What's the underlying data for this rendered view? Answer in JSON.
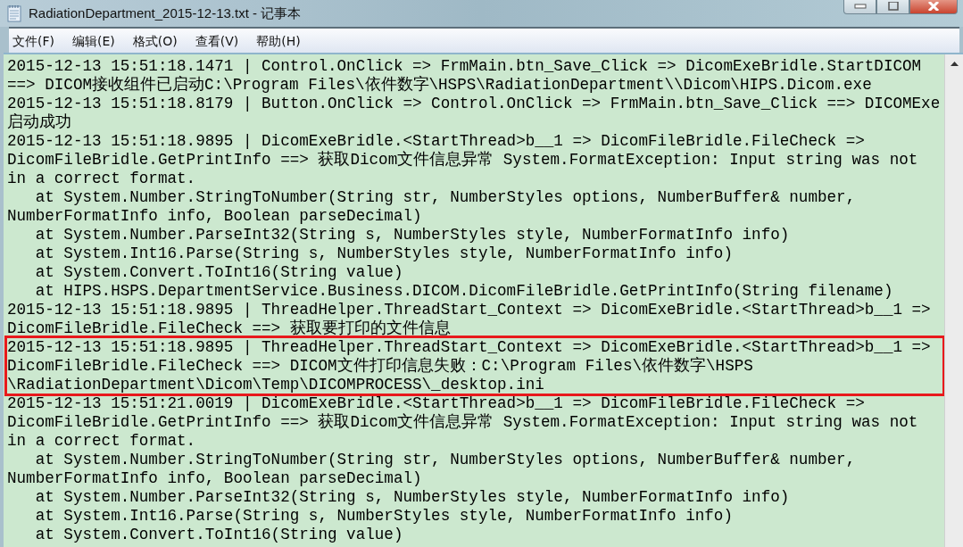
{
  "window": {
    "title": "RadiationDepartment_2015-12-13.txt - 记事本"
  },
  "menu": [
    "文件(F)",
    "编辑(E)",
    "格式(O)",
    "查看(V)",
    "帮助(H)"
  ],
  "lines": [
    {
      "text": "2015-12-13 15:51:18.1471 | Control.OnClick => FrmMain.btn_Save_Click => DicomExeBridle.StartDICOM",
      "boxed": false
    },
    {
      "text": "==> DICOM接收组件已启动C:\\Program Files\\依件数字\\HSPS\\RadiationDepartment\\\\Dicom\\HIPS.Dicom.exe",
      "boxed": false
    },
    {
      "text": "2015-12-13 15:51:18.8179 | Button.OnClick => Control.OnClick => FrmMain.btn_Save_Click ==> DICOMExe",
      "boxed": false
    },
    {
      "text": "启动成功",
      "boxed": false
    },
    {
      "text": "2015-12-13 15:51:18.9895 | DicomExeBridle.<StartThread>b__1 => DicomFileBridle.FileCheck =>",
      "boxed": false
    },
    {
      "text": "DicomFileBridle.GetPrintInfo ==> 获取Dicom文件信息异常 System.FormatException: Input string was not",
      "boxed": false
    },
    {
      "text": "in a correct format.",
      "boxed": false
    },
    {
      "text": "   at System.Number.StringToNumber(String str, NumberStyles options, NumberBuffer& number,",
      "boxed": false
    },
    {
      "text": "NumberFormatInfo info, Boolean parseDecimal)",
      "boxed": false
    },
    {
      "text": "   at System.Number.ParseInt32(String s, NumberStyles style, NumberFormatInfo info)",
      "boxed": false
    },
    {
      "text": "   at System.Int16.Parse(String s, NumberStyles style, NumberFormatInfo info)",
      "boxed": false
    },
    {
      "text": "   at System.Convert.ToInt16(String value)",
      "boxed": false
    },
    {
      "text": "   at HIPS.HSPS.DepartmentService.Business.DICOM.DicomFileBridle.GetPrintInfo(String filename)",
      "boxed": false
    },
    {
      "text": "2015-12-13 15:51:18.9895 | ThreadHelper.ThreadStart_Context => DicomExeBridle.<StartThread>b__1 =>",
      "boxed": false
    },
    {
      "text": "DicomFileBridle.FileCheck ==> 获取要打印的文件信息",
      "boxed": false
    },
    {
      "text": "2015-12-13 15:51:18.9895 | ThreadHelper.ThreadStart_Context => DicomExeBridle.<StartThread>b__1 =>",
      "boxed": true
    },
    {
      "text": "DicomFileBridle.FileCheck ==> DICOM文件打印信息失败：C:\\Program Files\\依件数字\\HSPS",
      "boxed": true
    },
    {
      "text": "\\RadiationDepartment\\Dicom\\Temp\\DICOMPROCESS\\_desktop.ini",
      "boxed": true
    },
    {
      "text": "2015-12-13 15:51:21.0019 | DicomExeBridle.<StartThread>b__1 => DicomFileBridle.FileCheck =>",
      "boxed": false
    },
    {
      "text": "DicomFileBridle.GetPrintInfo ==> 获取Dicom文件信息异常 System.FormatException: Input string was not",
      "boxed": false
    },
    {
      "text": "in a correct format.",
      "boxed": false
    },
    {
      "text": "   at System.Number.StringToNumber(String str, NumberStyles options, NumberBuffer& number,",
      "boxed": false
    },
    {
      "text": "NumberFormatInfo info, Boolean parseDecimal)",
      "boxed": false
    },
    {
      "text": "   at System.Number.ParseInt32(String s, NumberStyles style, NumberFormatInfo info)",
      "boxed": false
    },
    {
      "text": "   at System.Int16.Parse(String s, NumberStyles style, NumberFormatInfo info)",
      "boxed": false
    },
    {
      "text": "   at System.Convert.ToInt16(String value)",
      "boxed": false
    }
  ]
}
